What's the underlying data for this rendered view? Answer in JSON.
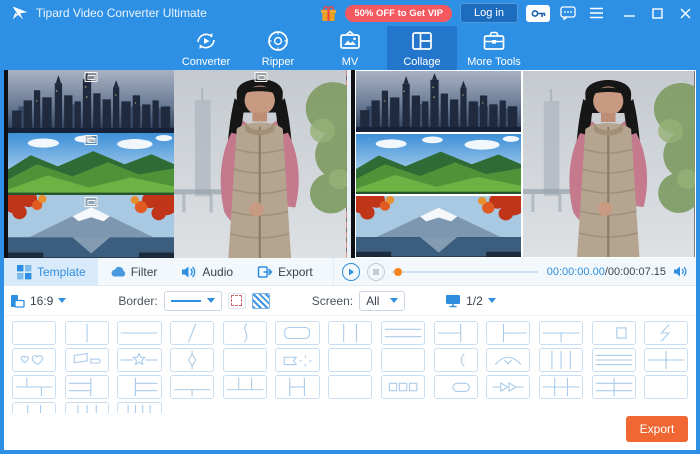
{
  "titlebar": {
    "app_title": "Tipard Video Converter Ultimate",
    "vip_badge": "50% OFF to Get VIP",
    "login_label": "Log in"
  },
  "nav": {
    "tabs": [
      {
        "label": "Converter",
        "icon": "converter-icon",
        "active": false
      },
      {
        "label": "Ripper",
        "icon": "ripper-icon",
        "active": false
      },
      {
        "label": "MV",
        "icon": "mv-icon",
        "active": false
      },
      {
        "label": "Collage",
        "icon": "collage-icon",
        "active": true
      },
      {
        "label": "More Tools",
        "icon": "toolbox-icon",
        "active": false
      }
    ]
  },
  "collage": {
    "cells": [
      {
        "scene": "city",
        "label": "city skyline video",
        "selected": false
      },
      {
        "scene": "mountain",
        "label": "green mountains video",
        "selected": false
      },
      {
        "scene": "autumn",
        "label": "autumn lake video",
        "selected": false
      },
      {
        "scene": "woman",
        "label": "woman jogging video",
        "selected": true
      }
    ]
  },
  "controls": {
    "tabs": [
      {
        "label": "Template",
        "icon": "template-icon",
        "active": true
      },
      {
        "label": "Filter",
        "icon": "filter-icon",
        "active": false
      },
      {
        "label": "Audio",
        "icon": "audio-icon",
        "active": false
      },
      {
        "label": "Export",
        "icon": "export-icon",
        "active": false
      }
    ],
    "time_current": "00:00:00.00",
    "time_total": "/00:00:07.15"
  },
  "toolbar": {
    "aspect_value": "16:9",
    "border_label": "Border:",
    "screen_label": "Screen:",
    "screen_value": "All",
    "page_value": "1/2"
  },
  "templates": {
    "rows": [
      [
        "single",
        "split-v",
        "split-h",
        "diagonal",
        "curve",
        "rounded-inset",
        "cols-3",
        "rows-3",
        "left-rows",
        "right-rows",
        "bottom-col",
        "circle-square",
        "lightning"
      ],
      [
        "hearts",
        "flags",
        "star-line",
        "diamond-line",
        "circles-2",
        "flag-gear",
        "rings-2",
        "clover",
        "blob-paren",
        "heart-arc",
        "cols-4",
        "rows-4",
        "cross-2x2"
      ],
      [
        "grid-offset",
        "rows-left-col",
        "col-rows-right",
        "bottom-split-low",
        "top-cols-3",
        "h-split",
        "circles-3",
        "squares-3",
        "capsules",
        "play-arrows",
        "grid-3x2",
        "grid-2x3w",
        "dots"
      ],
      [
        "cols-3",
        "cols-4",
        "cols-5"
      ]
    ]
  },
  "export_label": "Export",
  "colors": {
    "titlebar_blue": "#2e90e4",
    "active_tab_blue": "#2376cc",
    "accent_blue": "#2e8fe0",
    "vip_red": "#f4595f",
    "export_orange": "#f06733",
    "selection_red": "#e6432c",
    "slider_thumb_orange": "#f5831f"
  }
}
